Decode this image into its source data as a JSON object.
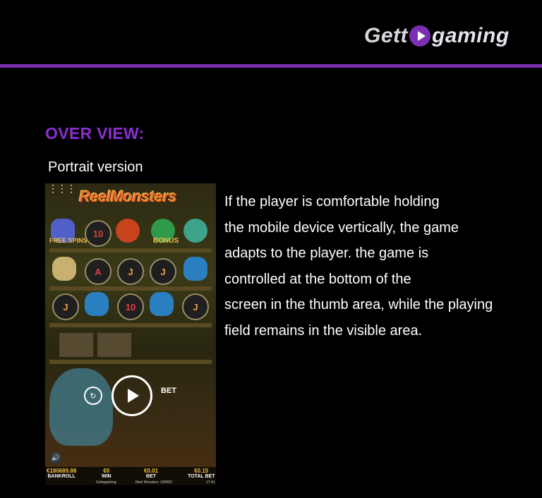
{
  "logo": {
    "part1": "Gett",
    "part2": "gaming"
  },
  "section_title": "OVER VIEW:",
  "subtitle": "Portrait version",
  "description_lines": [
    "If the player is comfortable holding",
    "the mobile device vertically, the game",
    "adapts to the player. the game is",
    "controlled at the bottom of the",
    "screen in the thumb area, while the playing",
    "field remains in the visible area."
  ],
  "game": {
    "title": "ReelMonsters",
    "symbols": {
      "free_spins": "FREE SPINS",
      "bonus": "BONUS",
      "ten": "10",
      "ace": "A",
      "jack": "J"
    },
    "bet_button": "BET",
    "stats": {
      "bankroll_value": "€180689.88",
      "bankroll_label": "BANKROLL",
      "win_value": "€0",
      "win_label": "WIN",
      "bet_value": "€0.01",
      "bet_label": "BET",
      "total_bet_value": "€0.15",
      "total_bet_label": "TOTAL BET"
    },
    "footer_brand": "Gettagaming",
    "footer_game": "Reel Monsters: 100003",
    "footer_time": "17:41"
  },
  "colors": {
    "accent": "#7b2fb0",
    "heading": "#8b2fd0",
    "background": "#000000"
  }
}
